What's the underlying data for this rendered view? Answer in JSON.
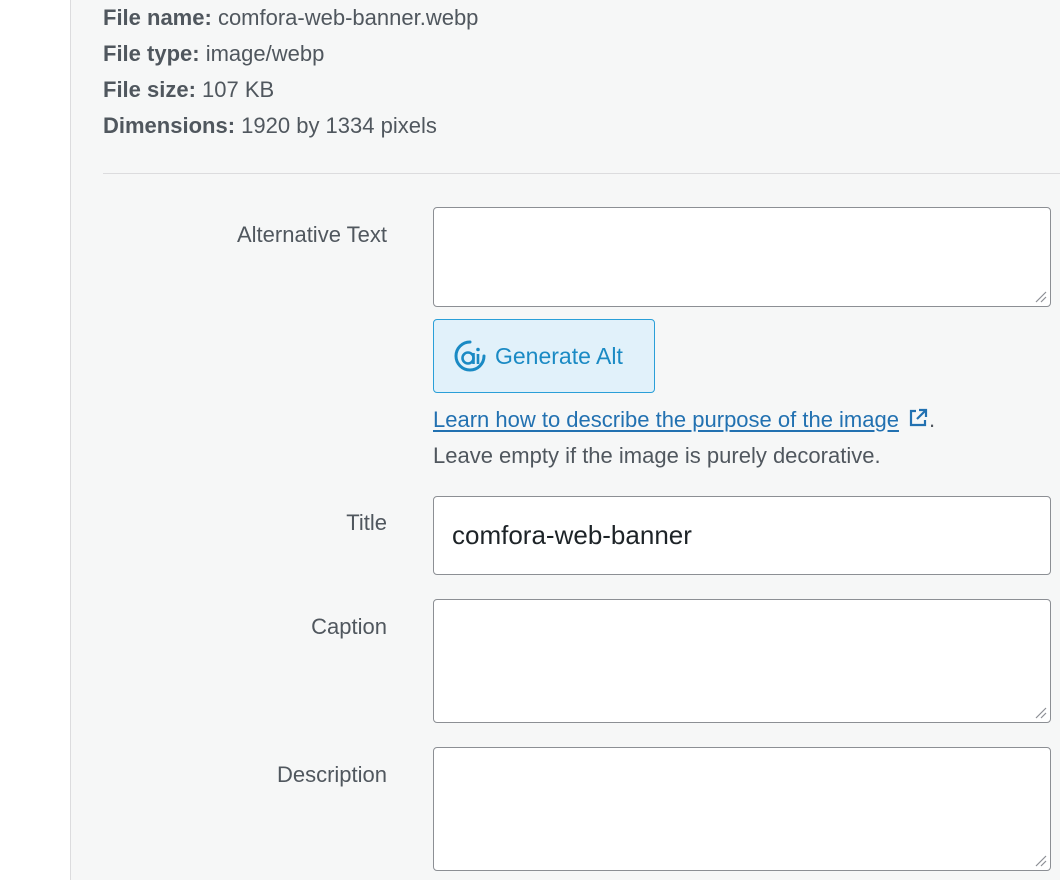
{
  "file_details": {
    "file_name_label": "File name:",
    "file_name": "comfora-web-banner.webp",
    "file_type_label": "File type:",
    "file_type": "image/webp",
    "file_size_label": "File size:",
    "file_size": "107 KB",
    "dimensions_label": "Dimensions:",
    "dimensions": "1920 by 1334 pixels"
  },
  "fields": {
    "alt_text": {
      "label": "Alternative Text",
      "value": ""
    },
    "generate_alt": {
      "label": "Generate Alt",
      "icon": "ai-icon"
    },
    "help": {
      "link_text": "Learn how to describe the purpose of the image",
      "link_icon": "external-link-icon",
      "period": ".",
      "note": "Leave empty if the image is purely decorative."
    },
    "title": {
      "label": "Title",
      "value": "comfora-web-banner"
    },
    "caption": {
      "label": "Caption",
      "value": ""
    },
    "description": {
      "label": "Description",
      "value": ""
    }
  },
  "colors": {
    "panel_background": "#f6f7f7",
    "text": "#50575e",
    "link": "#2271b1",
    "accent": "#2a9fd8",
    "button_background": "#e1f1fa"
  }
}
